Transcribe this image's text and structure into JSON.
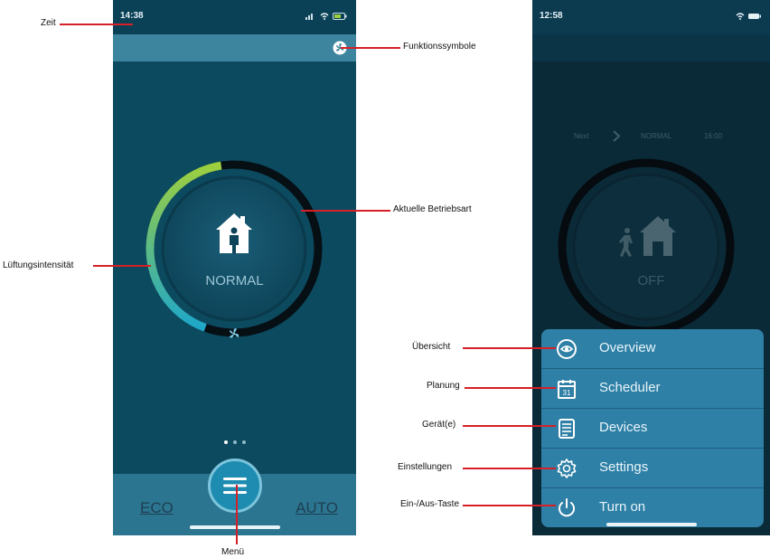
{
  "annotations": {
    "zeit": "Zeit",
    "funktionssymbole": "Funktionssymbole",
    "aktuelle_betriebsart": "Aktuelle Betriebsart",
    "lueftungsintensitaet": "Lüftungsintensität",
    "menu": "Menü",
    "uebersicht": "Übersicht",
    "planung": "Planung",
    "geraete": "Gerät(e)",
    "einstellungen": "Einstellungen",
    "ein_aus_taste": "Ein-/Aus-Taste"
  },
  "phone1": {
    "time": "14:38",
    "mode": "NORMAL",
    "intensity_fraction": 0.42,
    "eco_label": "ECO",
    "auto_label": "AUTO",
    "page_dots": 3,
    "active_dot": 0
  },
  "phone2": {
    "time": "12:58",
    "next_label": "Next",
    "next_mode": "NORMAL",
    "next_time": "16:00",
    "mode": "OFF",
    "menu": [
      {
        "icon": "overview-icon",
        "label": "Overview"
      },
      {
        "icon": "calendar-icon",
        "label": "Scheduler"
      },
      {
        "icon": "devices-icon",
        "label": "Devices"
      },
      {
        "icon": "gear-icon",
        "label": "Settings"
      },
      {
        "icon": "power-icon",
        "label": "Turn on"
      }
    ]
  },
  "colors": {
    "app_background": "#0c4a60",
    "arc_start": "#9dcf3f",
    "arc_end": "#1ea7c9",
    "menu_panel": "#2f80a6",
    "annotation_line": "#d61f26"
  }
}
